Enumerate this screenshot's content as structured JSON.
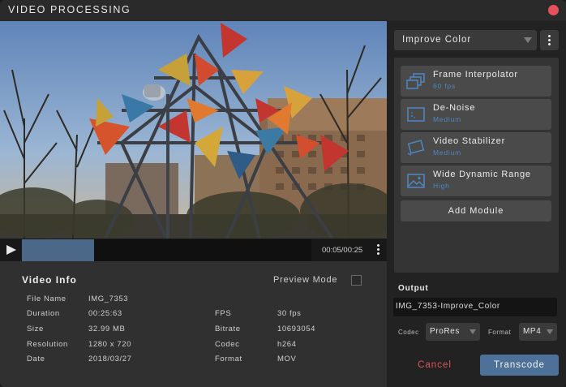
{
  "window": {
    "title": "VIDEO PROCESSING"
  },
  "player": {
    "timecode": "00:05/00:25",
    "progress_fraction": 0.25,
    "icons": {
      "play": "play-icon",
      "more": "more-vertical-icon"
    }
  },
  "video_info": {
    "title": "Video Info",
    "preview_mode_label": "Preview Mode",
    "preview_mode_checked": false,
    "left_rows": [
      {
        "label": "File Name",
        "value": "IMG_7353"
      },
      {
        "label": "Duration",
        "value": "00:25:63"
      },
      {
        "label": "Size",
        "value": "32.99 MB"
      },
      {
        "label": "Resolution",
        "value": "1280 x 720"
      },
      {
        "label": "Date",
        "value": "2018/03/27"
      }
    ],
    "right_rows": [
      {
        "label": "FPS",
        "value": "30 fps"
      },
      {
        "label": "Bitrate",
        "value": "10693054"
      },
      {
        "label": "Codec",
        "value": "h264"
      },
      {
        "label": "Format",
        "value": "MOV"
      }
    ]
  },
  "preset": {
    "selected": "Improve Color"
  },
  "modules": [
    {
      "name": "Frame Interpolator",
      "detail": "60 fps",
      "icon": "frames-icon"
    },
    {
      "name": "De-Noise",
      "detail": "Medium",
      "icon": "denoise-icon"
    },
    {
      "name": "Video Stabilizer",
      "detail": "Medium",
      "icon": "stabilizer-icon"
    },
    {
      "name": "Wide Dynamic Range",
      "detail": "High",
      "icon": "image-icon"
    }
  ],
  "add_module_label": "Add Module",
  "output": {
    "title": "Output",
    "filename": "IMG_7353-Improve_Color",
    "codec_label": "Codec",
    "codec_value": "ProRes",
    "format_label": "Format",
    "format_value": "MP4"
  },
  "actions": {
    "cancel": "Cancel",
    "transcode": "Transcode"
  },
  "colors": {
    "accent": "#4d7199",
    "danger": "#e0545c",
    "module_detail": "#4f87c3",
    "close": "#e8505b"
  }
}
